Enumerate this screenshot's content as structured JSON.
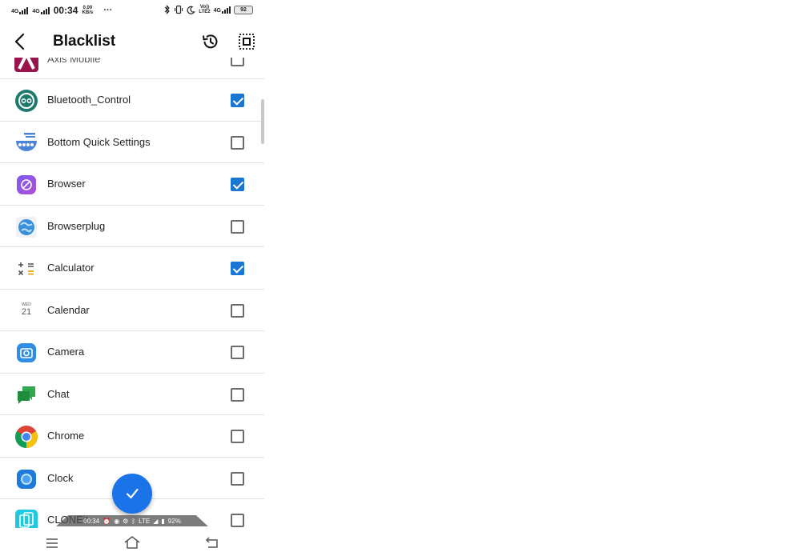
{
  "status_bar": {
    "net1": "4G",
    "net2": "4G",
    "time": "00:34",
    "speed_value": "0.00",
    "speed_unit": "KB/s",
    "more": "···",
    "volte_top": "Vo))",
    "volte_bottom": "LTE2",
    "net3": "4G",
    "battery": "92"
  },
  "app_bar": {
    "title": "Blacklist"
  },
  "apps": [
    {
      "name": "Axis Mobile",
      "checked": false,
      "icon": "axis-icon"
    },
    {
      "name": "Bluetooth_Control",
      "checked": true,
      "icon": "bluetooth-control-icon"
    },
    {
      "name": "Bottom Quick Settings",
      "checked": false,
      "icon": "bottom-quick-settings-icon"
    },
    {
      "name": "Browser",
      "checked": true,
      "icon": "browser-icon"
    },
    {
      "name": "Browserplug",
      "checked": false,
      "icon": "browserplug-icon"
    },
    {
      "name": "Calculator",
      "checked": true,
      "icon": "calculator-icon"
    },
    {
      "name": "Calendar",
      "checked": false,
      "icon": "calendar-icon",
      "icon_text_top": "WED",
      "icon_text_num": "21"
    },
    {
      "name": "Camera",
      "checked": false,
      "icon": "camera-icon"
    },
    {
      "name": "Chat",
      "checked": false,
      "icon": "chat-icon"
    },
    {
      "name": "Chrome",
      "checked": false,
      "icon": "chrome-icon"
    },
    {
      "name": "Clock",
      "checked": false,
      "icon": "clock-icon"
    },
    {
      "name": "CLONEit",
      "checked": false,
      "icon": "cloneit-icon"
    }
  ],
  "overlay": {
    "time": "00:34",
    "network": "LTE",
    "battery": "92%"
  },
  "colors": {
    "accent": "#1976d2",
    "fab": "#1a73e8"
  }
}
